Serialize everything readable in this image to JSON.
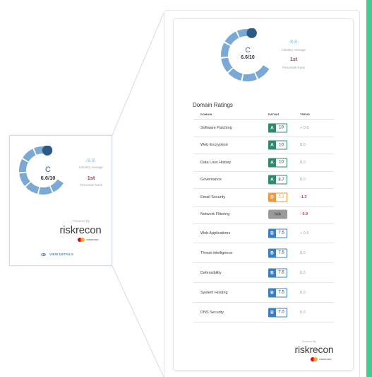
{
  "colors": {
    "gauge_fill": "#7aa9d6",
    "gauge_track": "#dde5ec",
    "gauge_marker": "#2b5a84",
    "grade_a": "#2f8a6c",
    "grade_d": "#eb9a45",
    "grade_b": "#3b7fc0",
    "grade_na": "#9a9a9a",
    "trend_negative": "#c33a4e",
    "accent_right_bar": "#3ecf8e"
  },
  "widget": {
    "grade": "C",
    "score": "6.6/10",
    "score_fraction": 0.66,
    "industry_average": "8.8",
    "industry_average_label": "Industry Average",
    "percentile_rank": "1st",
    "percentile_rank_label": "Percentile Rank",
    "powered_by": "Powered By",
    "brand": "riskrecon",
    "brand_sub": "mastercard",
    "view_details_label": "VIEW DETAILS",
    "view_details_icon": "eye-icon"
  },
  "details": {
    "grade": "C",
    "score": "6.6/10",
    "industry_average": "8.8",
    "industry_average_label": "Industry Average",
    "percentile_rank": "1st",
    "percentile_rank_label": "Percentile Rank",
    "domain_ratings_title": "Domain Ratings",
    "columns": {
      "domain": "DOMAIN",
      "rating": "RATING",
      "trend": "TREND"
    },
    "rows": [
      {
        "domain": "Software Patching",
        "grade": "A",
        "rating": "10",
        "trend": "+ 0.6",
        "negative": false
      },
      {
        "domain": "Web Encryption",
        "grade": "A",
        "rating": "10",
        "trend": "0.0",
        "negative": false
      },
      {
        "domain": "Data Loss History",
        "grade": "A",
        "rating": "10",
        "trend": "0.0",
        "negative": false
      },
      {
        "domain": "Governance",
        "grade": "A",
        "rating": "8.7",
        "trend": "0.0",
        "negative": false
      },
      {
        "domain": "Email Security",
        "grade": "D",
        "rating": "5.2",
        "trend": "-1.3",
        "negative": true
      },
      {
        "domain": "Network Filtering",
        "grade": "",
        "rating": "N/A",
        "trend": "- 0.9",
        "negative": true
      },
      {
        "domain": "Web Applications",
        "grade": "B",
        "rating": "7.5",
        "trend": "+ 0.6",
        "negative": false
      },
      {
        "domain": "Threat Intelligence",
        "grade": "B",
        "rating": "7.5",
        "trend": "0.0",
        "negative": false
      },
      {
        "domain": "Defensibility",
        "grade": "B",
        "rating": "7.5",
        "trend": "0.0",
        "negative": false
      },
      {
        "domain": "System Hosting",
        "grade": "B",
        "rating": "7.5",
        "trend": "0.0",
        "negative": false
      },
      {
        "domain": "DNS Security",
        "grade": "B",
        "rating": "7.0",
        "trend": "0.0",
        "negative": false
      }
    ],
    "powered_by": "Powered By",
    "brand": "riskrecon",
    "brand_sub": "mastercard"
  }
}
